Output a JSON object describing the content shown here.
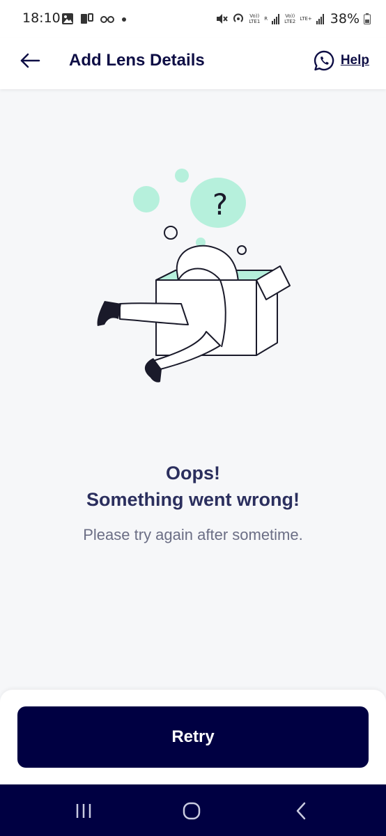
{
  "status_bar": {
    "time": "18:10",
    "sim1_label_top": "Vo))",
    "sim1_label_bottom": "LTE1",
    "sim1_roaming": "R",
    "sim2_label_top": "Vo))",
    "sim2_label_bottom": "LTE2",
    "sim2_network": "LTE+",
    "battery": "38%",
    "icons": [
      "gallery-icon",
      "screen-mirror-icon",
      "glasses-icon",
      "dot-icon",
      "mute-icon",
      "hotspot-icon",
      "signal-icon",
      "battery-icon"
    ]
  },
  "header": {
    "title": "Add Lens Details",
    "help_label": "Help",
    "back_icon": "arrow-left-icon",
    "help_icon": "whatsapp-icon"
  },
  "error": {
    "title_line1": "Oops!",
    "title_line2": "Something went wrong!",
    "subtitle": "Please try again after sometime.",
    "illustration_question": "?"
  },
  "footer": {
    "retry_label": "Retry"
  },
  "nav": {
    "icons": [
      "recent-apps-icon",
      "home-icon",
      "back-icon"
    ]
  },
  "colors": {
    "primary": "#000042",
    "title_text": "#2b2f5e",
    "subtitle_text": "#6b6e85",
    "accent_mint": "#b6f0dc",
    "background": "#f6f7f9"
  }
}
